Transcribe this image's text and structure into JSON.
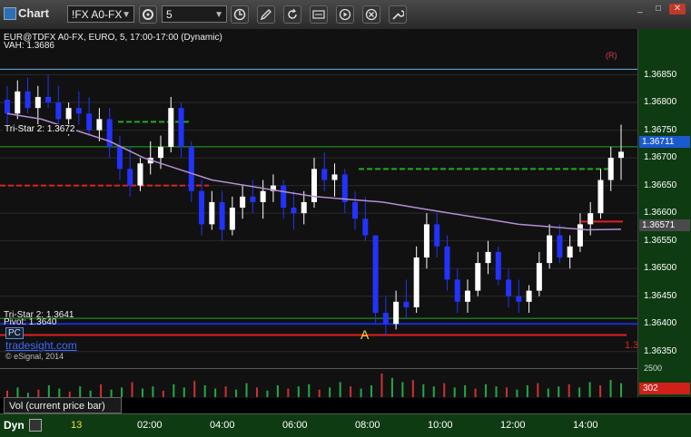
{
  "app": {
    "title": "Chart"
  },
  "toolbar": {
    "symbol": "!FX A0-FX",
    "interval": "5",
    "buttons": [
      "gear-icon",
      "clock-icon",
      "pencil-icon",
      "refresh-icon",
      "ticker-icon",
      "play-icon",
      "x-icon",
      "wrench-icon"
    ]
  },
  "chart": {
    "header": "EUR@TDFX A0-FX, EURO, 5, 17:00-17:00 (Dynamic)",
    "vah_label": "VAH: 1.3686",
    "tristar_top_label": "Tri-Star 2: 1.3672",
    "tristar_bottom_label": "Tri-Star 2: 1.3641",
    "pivot_label": "Pivot: 1.3640",
    "pc_label": "PC",
    "brand": "tradesight.com",
    "copyright": "© eSignal, 2014",
    "marker_a": "A",
    "marker_r": "(R)",
    "price_right_cut": "1.3",
    "last_price": "1.36711",
    "sma_price": "1.36571"
  },
  "chart_data": {
    "type": "candlestick",
    "y_ticks": [
      "1.36850",
      "1.36800",
      "1.36750",
      "1.36700",
      "1.36650",
      "1.36600",
      "1.36550",
      "1.36500",
      "1.36450",
      "1.36400",
      "1.36350"
    ],
    "ylim": [
      1.3633,
      1.369
    ],
    "x_ticks": [
      "13",
      "02:00",
      "04:00",
      "06:00",
      "08:00",
      "10:00",
      "12:00",
      "14:00"
    ],
    "levels": {
      "vah": 1.3686,
      "tristar_top": 1.3672,
      "tristar_bottom": 1.3641,
      "pivot": 1.364,
      "pc": 1.3638
    },
    "ohlc": [
      {
        "o": 1.36805,
        "h": 1.3683,
        "l": 1.3676,
        "c": 1.3678
      },
      {
        "o": 1.3678,
        "h": 1.3684,
        "l": 1.3677,
        "c": 1.3682
      },
      {
        "o": 1.3682,
        "h": 1.36845,
        "l": 1.3678,
        "c": 1.3679
      },
      {
        "o": 1.3679,
        "h": 1.3683,
        "l": 1.3676,
        "c": 1.3681
      },
      {
        "o": 1.3681,
        "h": 1.3685,
        "l": 1.3679,
        "c": 1.368
      },
      {
        "o": 1.368,
        "h": 1.3683,
        "l": 1.3676,
        "c": 1.3677
      },
      {
        "o": 1.3677,
        "h": 1.368,
        "l": 1.3674,
        "c": 1.3679
      },
      {
        "o": 1.3679,
        "h": 1.3682,
        "l": 1.3676,
        "c": 1.3678
      },
      {
        "o": 1.3678,
        "h": 1.3681,
        "l": 1.3674,
        "c": 1.3675
      },
      {
        "o": 1.3675,
        "h": 1.3679,
        "l": 1.3673,
        "c": 1.3677
      },
      {
        "o": 1.3677,
        "h": 1.3679,
        "l": 1.367,
        "c": 1.3672
      },
      {
        "o": 1.3672,
        "h": 1.3674,
        "l": 1.3666,
        "c": 1.3668
      },
      {
        "o": 1.3668,
        "h": 1.3672,
        "l": 1.3663,
        "c": 1.3665
      },
      {
        "o": 1.3665,
        "h": 1.367,
        "l": 1.3664,
        "c": 1.3669
      },
      {
        "o": 1.3669,
        "h": 1.3673,
        "l": 1.3667,
        "c": 1.367
      },
      {
        "o": 1.367,
        "h": 1.3674,
        "l": 1.3668,
        "c": 1.3672
      },
      {
        "o": 1.3672,
        "h": 1.3681,
        "l": 1.3671,
        "c": 1.3679
      },
      {
        "o": 1.3679,
        "h": 1.368,
        "l": 1.367,
        "c": 1.3672
      },
      {
        "o": 1.3672,
        "h": 1.3673,
        "l": 1.3662,
        "c": 1.3664
      },
      {
        "o": 1.3664,
        "h": 1.3666,
        "l": 1.3656,
        "c": 1.3658
      },
      {
        "o": 1.3658,
        "h": 1.3664,
        "l": 1.3657,
        "c": 1.3662
      },
      {
        "o": 1.3662,
        "h": 1.3664,
        "l": 1.3655,
        "c": 1.3657
      },
      {
        "o": 1.3657,
        "h": 1.3663,
        "l": 1.3656,
        "c": 1.3661
      },
      {
        "o": 1.3661,
        "h": 1.3665,
        "l": 1.3659,
        "c": 1.3663
      },
      {
        "o": 1.3663,
        "h": 1.3666,
        "l": 1.366,
        "c": 1.3662
      },
      {
        "o": 1.3662,
        "h": 1.3666,
        "l": 1.3659,
        "c": 1.3664
      },
      {
        "o": 1.3664,
        "h": 1.3667,
        "l": 1.3662,
        "c": 1.3665
      },
      {
        "o": 1.3665,
        "h": 1.3666,
        "l": 1.3659,
        "c": 1.3661
      },
      {
        "o": 1.3661,
        "h": 1.3664,
        "l": 1.3657,
        "c": 1.366
      },
      {
        "o": 1.366,
        "h": 1.3664,
        "l": 1.3658,
        "c": 1.3662
      },
      {
        "o": 1.3662,
        "h": 1.367,
        "l": 1.3661,
        "c": 1.3668
      },
      {
        "o": 1.3668,
        "h": 1.3671,
        "l": 1.3664,
        "c": 1.3666
      },
      {
        "o": 1.3666,
        "h": 1.3669,
        "l": 1.3663,
        "c": 1.3667
      },
      {
        "o": 1.3667,
        "h": 1.3668,
        "l": 1.366,
        "c": 1.3662
      },
      {
        "o": 1.3662,
        "h": 1.3664,
        "l": 1.3657,
        "c": 1.3659
      },
      {
        "o": 1.3659,
        "h": 1.3663,
        "l": 1.3655,
        "c": 1.3656
      },
      {
        "o": 1.3656,
        "h": 1.3646,
        "l": 1.364,
        "c": 1.3642
      },
      {
        "o": 1.3642,
        "h": 1.3645,
        "l": 1.3638,
        "c": 1.364
      },
      {
        "o": 1.364,
        "h": 1.3646,
        "l": 1.3639,
        "c": 1.3644
      },
      {
        "o": 1.3644,
        "h": 1.3648,
        "l": 1.3641,
        "c": 1.3643
      },
      {
        "o": 1.3643,
        "h": 1.3654,
        "l": 1.3642,
        "c": 1.3652
      },
      {
        "o": 1.3652,
        "h": 1.366,
        "l": 1.365,
        "c": 1.3658
      },
      {
        "o": 1.3658,
        "h": 1.366,
        "l": 1.3652,
        "c": 1.3654
      },
      {
        "o": 1.3654,
        "h": 1.3656,
        "l": 1.3646,
        "c": 1.3648
      },
      {
        "o": 1.3648,
        "h": 1.365,
        "l": 1.3642,
        "c": 1.3644
      },
      {
        "o": 1.3644,
        "h": 1.3648,
        "l": 1.3642,
        "c": 1.3646
      },
      {
        "o": 1.3646,
        "h": 1.3653,
        "l": 1.3645,
        "c": 1.3651
      },
      {
        "o": 1.3651,
        "h": 1.3655,
        "l": 1.3649,
        "c": 1.3653
      },
      {
        "o": 1.3653,
        "h": 1.3654,
        "l": 1.3647,
        "c": 1.3648
      },
      {
        "o": 1.3648,
        "h": 1.365,
        "l": 1.3643,
        "c": 1.3645
      },
      {
        "o": 1.3645,
        "h": 1.3648,
        "l": 1.3642,
        "c": 1.3644
      },
      {
        "o": 1.3644,
        "h": 1.3647,
        "l": 1.3642,
        "c": 1.3646
      },
      {
        "o": 1.3646,
        "h": 1.3653,
        "l": 1.3645,
        "c": 1.3651
      },
      {
        "o": 1.3651,
        "h": 1.3658,
        "l": 1.365,
        "c": 1.3656
      },
      {
        "o": 1.3656,
        "h": 1.3658,
        "l": 1.3651,
        "c": 1.3652
      },
      {
        "o": 1.3652,
        "h": 1.3656,
        "l": 1.365,
        "c": 1.3654
      },
      {
        "o": 1.3654,
        "h": 1.366,
        "l": 1.3653,
        "c": 1.3658
      },
      {
        "o": 1.3658,
        "h": 1.3662,
        "l": 1.3656,
        "c": 1.366
      },
      {
        "o": 1.366,
        "h": 1.3668,
        "l": 1.3659,
        "c": 1.3666
      },
      {
        "o": 1.3666,
        "h": 1.3672,
        "l": 1.3664,
        "c": 1.367
      },
      {
        "o": 1.367,
        "h": 1.3676,
        "l": 1.3666,
        "c": 1.36711
      }
    ],
    "sma": [
      1.3678,
      1.3677,
      1.3675,
      1.3673,
      1.367,
      1.3668,
      1.3666,
      1.3665,
      1.3664,
      1.3663,
      1.36625,
      1.3662,
      1.3661,
      1.366,
      1.3659,
      1.3658,
      1.36575,
      1.3657,
      1.36571
    ]
  },
  "volume": {
    "tab_label": "Vol (current price bar)",
    "top_value": "2500",
    "current": "302",
    "bars": [
      6,
      9,
      4,
      7,
      11,
      8,
      5,
      10,
      6,
      12,
      7,
      9,
      14,
      8,
      10,
      6,
      12,
      9,
      15,
      11,
      8,
      10,
      7,
      13,
      9,
      6,
      11,
      8,
      10,
      12,
      7,
      9,
      14,
      10,
      8,
      11,
      22,
      18,
      14,
      16,
      12,
      10,
      13,
      9,
      11,
      8,
      12,
      10,
      9,
      7,
      11,
      13,
      8,
      10,
      12,
      9,
      14,
      11,
      16,
      13
    ]
  },
  "timebar": {
    "label": "Dyn"
  },
  "colors": {
    "up": "#ffffff",
    "down": "#2233ff",
    "sma": "#b38fd6",
    "pivot": "#1a2bd8",
    "tristar": "#22aa22",
    "red_level": "#e02020"
  }
}
